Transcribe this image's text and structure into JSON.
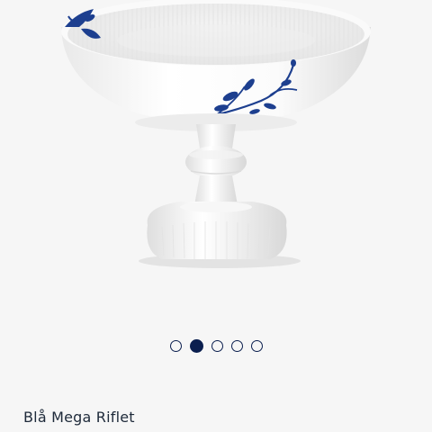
{
  "product": {
    "name": "Blå Mega Riflet"
  },
  "carousel": {
    "slide_count": 5,
    "active_index": 1
  },
  "colors": {
    "background": "#f6f6f6",
    "accent": "#0b1f4f",
    "porcelain": "#ffffff",
    "pattern": "#1d3f8f"
  }
}
